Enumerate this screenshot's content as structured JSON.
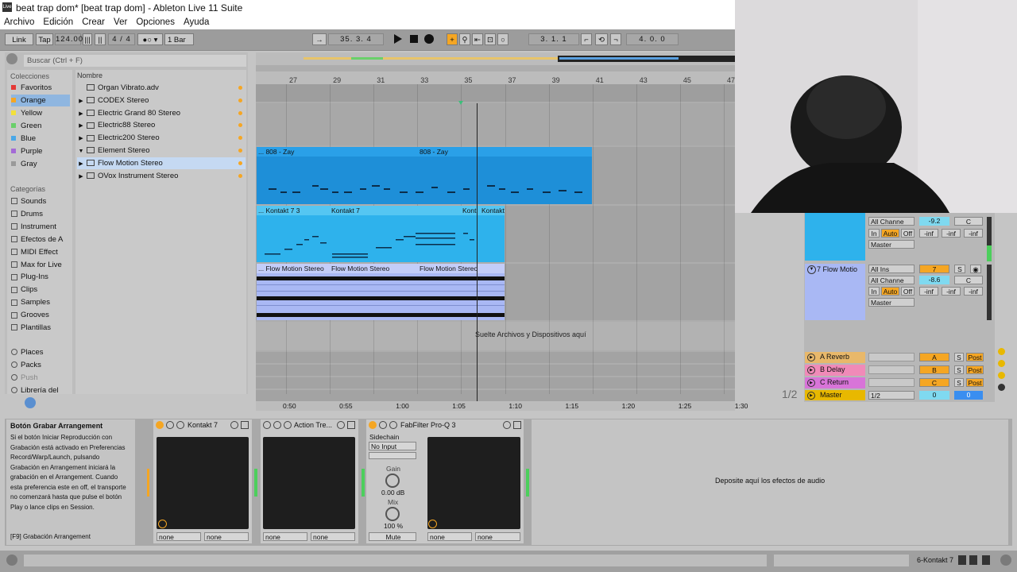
{
  "window": {
    "title": "beat trap dom*  [beat trap dom] - Ableton Live 11 Suite",
    "logo_text": "Live"
  },
  "menu": [
    "Archivo",
    "Edición",
    "Crear",
    "Ver",
    "Opciones",
    "Ayuda"
  ],
  "control_bar": {
    "link": "Link",
    "tap": "Tap",
    "tempo": "124.00",
    "time_sig": "4 / 4",
    "quantize": "1 Bar",
    "position": "35.  3.  4",
    "loop_start": "3.  1.  1",
    "loop_length": "4.  0.  0"
  },
  "browser": {
    "search_placeholder": "Buscar (Ctrl + F)",
    "collections_header": "Colecciones",
    "collections": [
      {
        "label": "Favoritos",
        "color": "#e53935"
      },
      {
        "label": "Orange",
        "color": "#f5a623"
      },
      {
        "label": "Yellow",
        "color": "#f2e03a"
      },
      {
        "label": "Green",
        "color": "#6ad06a"
      },
      {
        "label": "Blue",
        "color": "#4aa8e8"
      },
      {
        "label": "Purple",
        "color": "#a46bd6"
      },
      {
        "label": "Gray",
        "color": "#9a9a9a"
      }
    ],
    "categories_header": "Categorías",
    "categories": [
      "Sounds",
      "Drums",
      "Instrument",
      "Efectos de A",
      "MIDI Effect",
      "Max for Live",
      "Plug-Ins",
      "Clips",
      "Samples",
      "Grooves",
      "Plantillas"
    ],
    "places": [
      "Places",
      "Packs",
      "Push",
      "Librería del"
    ],
    "name_header": "Nombre",
    "files": [
      {
        "name": "Organ Vibrato.adv",
        "arrow": ""
      },
      {
        "name": "CODEX Stereo",
        "arrow": "▶"
      },
      {
        "name": "Electric Grand 80 Stereo",
        "arrow": "▶"
      },
      {
        "name": "Electric88 Stereo",
        "arrow": "▶"
      },
      {
        "name": "Electric200 Stereo",
        "arrow": "▶"
      },
      {
        "name": "Element Stereo",
        "arrow": "▼"
      },
      {
        "name": "Flow Motion Stereo",
        "arrow": "▶"
      },
      {
        "name": "OVox Instrument Stereo",
        "arrow": "▶"
      }
    ]
  },
  "arrangement": {
    "bars": [
      "27",
      "29",
      "31",
      "33",
      "35",
      "37",
      "39",
      "41",
      "43",
      "45",
      "47"
    ],
    "times": [
      "0:50",
      "0:55",
      "1:00",
      "1:05",
      "1:10",
      "1:15",
      "1:20",
      "1:25",
      "1:30"
    ],
    "clips_808": [
      "... 808 - Zay",
      "808 - Zay"
    ],
    "clips_kontakt": [
      "... Kontakt 7 3",
      "Kontakt 7",
      "Kont",
      "Kontakt"
    ],
    "clips_flow": [
      "... Flow Motion Stereo",
      "Flow Motion Stereo",
      "Flow Motion Stereo"
    ],
    "drop_text": "Suelte Archivos y Dispositivos aquí",
    "page": "1/2"
  },
  "mixer": {
    "track6": {
      "input": "All Channe",
      "vol": "-9.2",
      "pan": "C",
      "out": "Master"
    },
    "track7": {
      "name": "7 Flow Motio",
      "input_type": "All Ins",
      "input_ch": "All Channe",
      "num": "7",
      "vol": "-8.6",
      "pan": "C",
      "out": "Master"
    },
    "monitor": {
      "in": "In",
      "auto": "Auto",
      "off": "Off"
    },
    "meters": [
      "-inf",
      "-inf",
      "-inf"
    ],
    "returns": [
      {
        "name": "A Reverb",
        "letter": "A",
        "color": "#e8b86a"
      },
      {
        "name": "B Delay",
        "letter": "B",
        "color": "#f08ab8"
      },
      {
        "name": "C Return",
        "letter": "C",
        "color": "#d874d8"
      }
    ],
    "master": {
      "name": "Master",
      "cue": "1/2",
      "vol": "0",
      "pan": "0"
    },
    "post": "Post",
    "solo": "S"
  },
  "info": {
    "title": "Botón Grabar Arrangement",
    "body": "Si el botón Iniciar Reproducción con Grabación está activado en Preferencias Record/Warp/Launch, pulsando Grabación en Arrangement iniciará la grabación en el Arrangement. Cuando esta preferencia este en off, el transporte no comenzará hasta que pulse el botón Play o lance clips en Session.",
    "shortcut": "[F9] Grabación Arrangement"
  },
  "devices": {
    "kontakt": "Kontakt 7",
    "action": "Action Tre...",
    "fabfilter": "FabFilter Pro-Q 3",
    "sidechain": "Sidechain",
    "no_input": "No Input",
    "gain_label": "Gain",
    "gain_value": "0.00 dB",
    "mix_label": "Mix",
    "mix_value": "100 %",
    "mute": "Mute",
    "none": "none",
    "drop_effects": "Deposite aquí los efectos de audio"
  },
  "status": {
    "track": "6-Kontakt 7"
  }
}
